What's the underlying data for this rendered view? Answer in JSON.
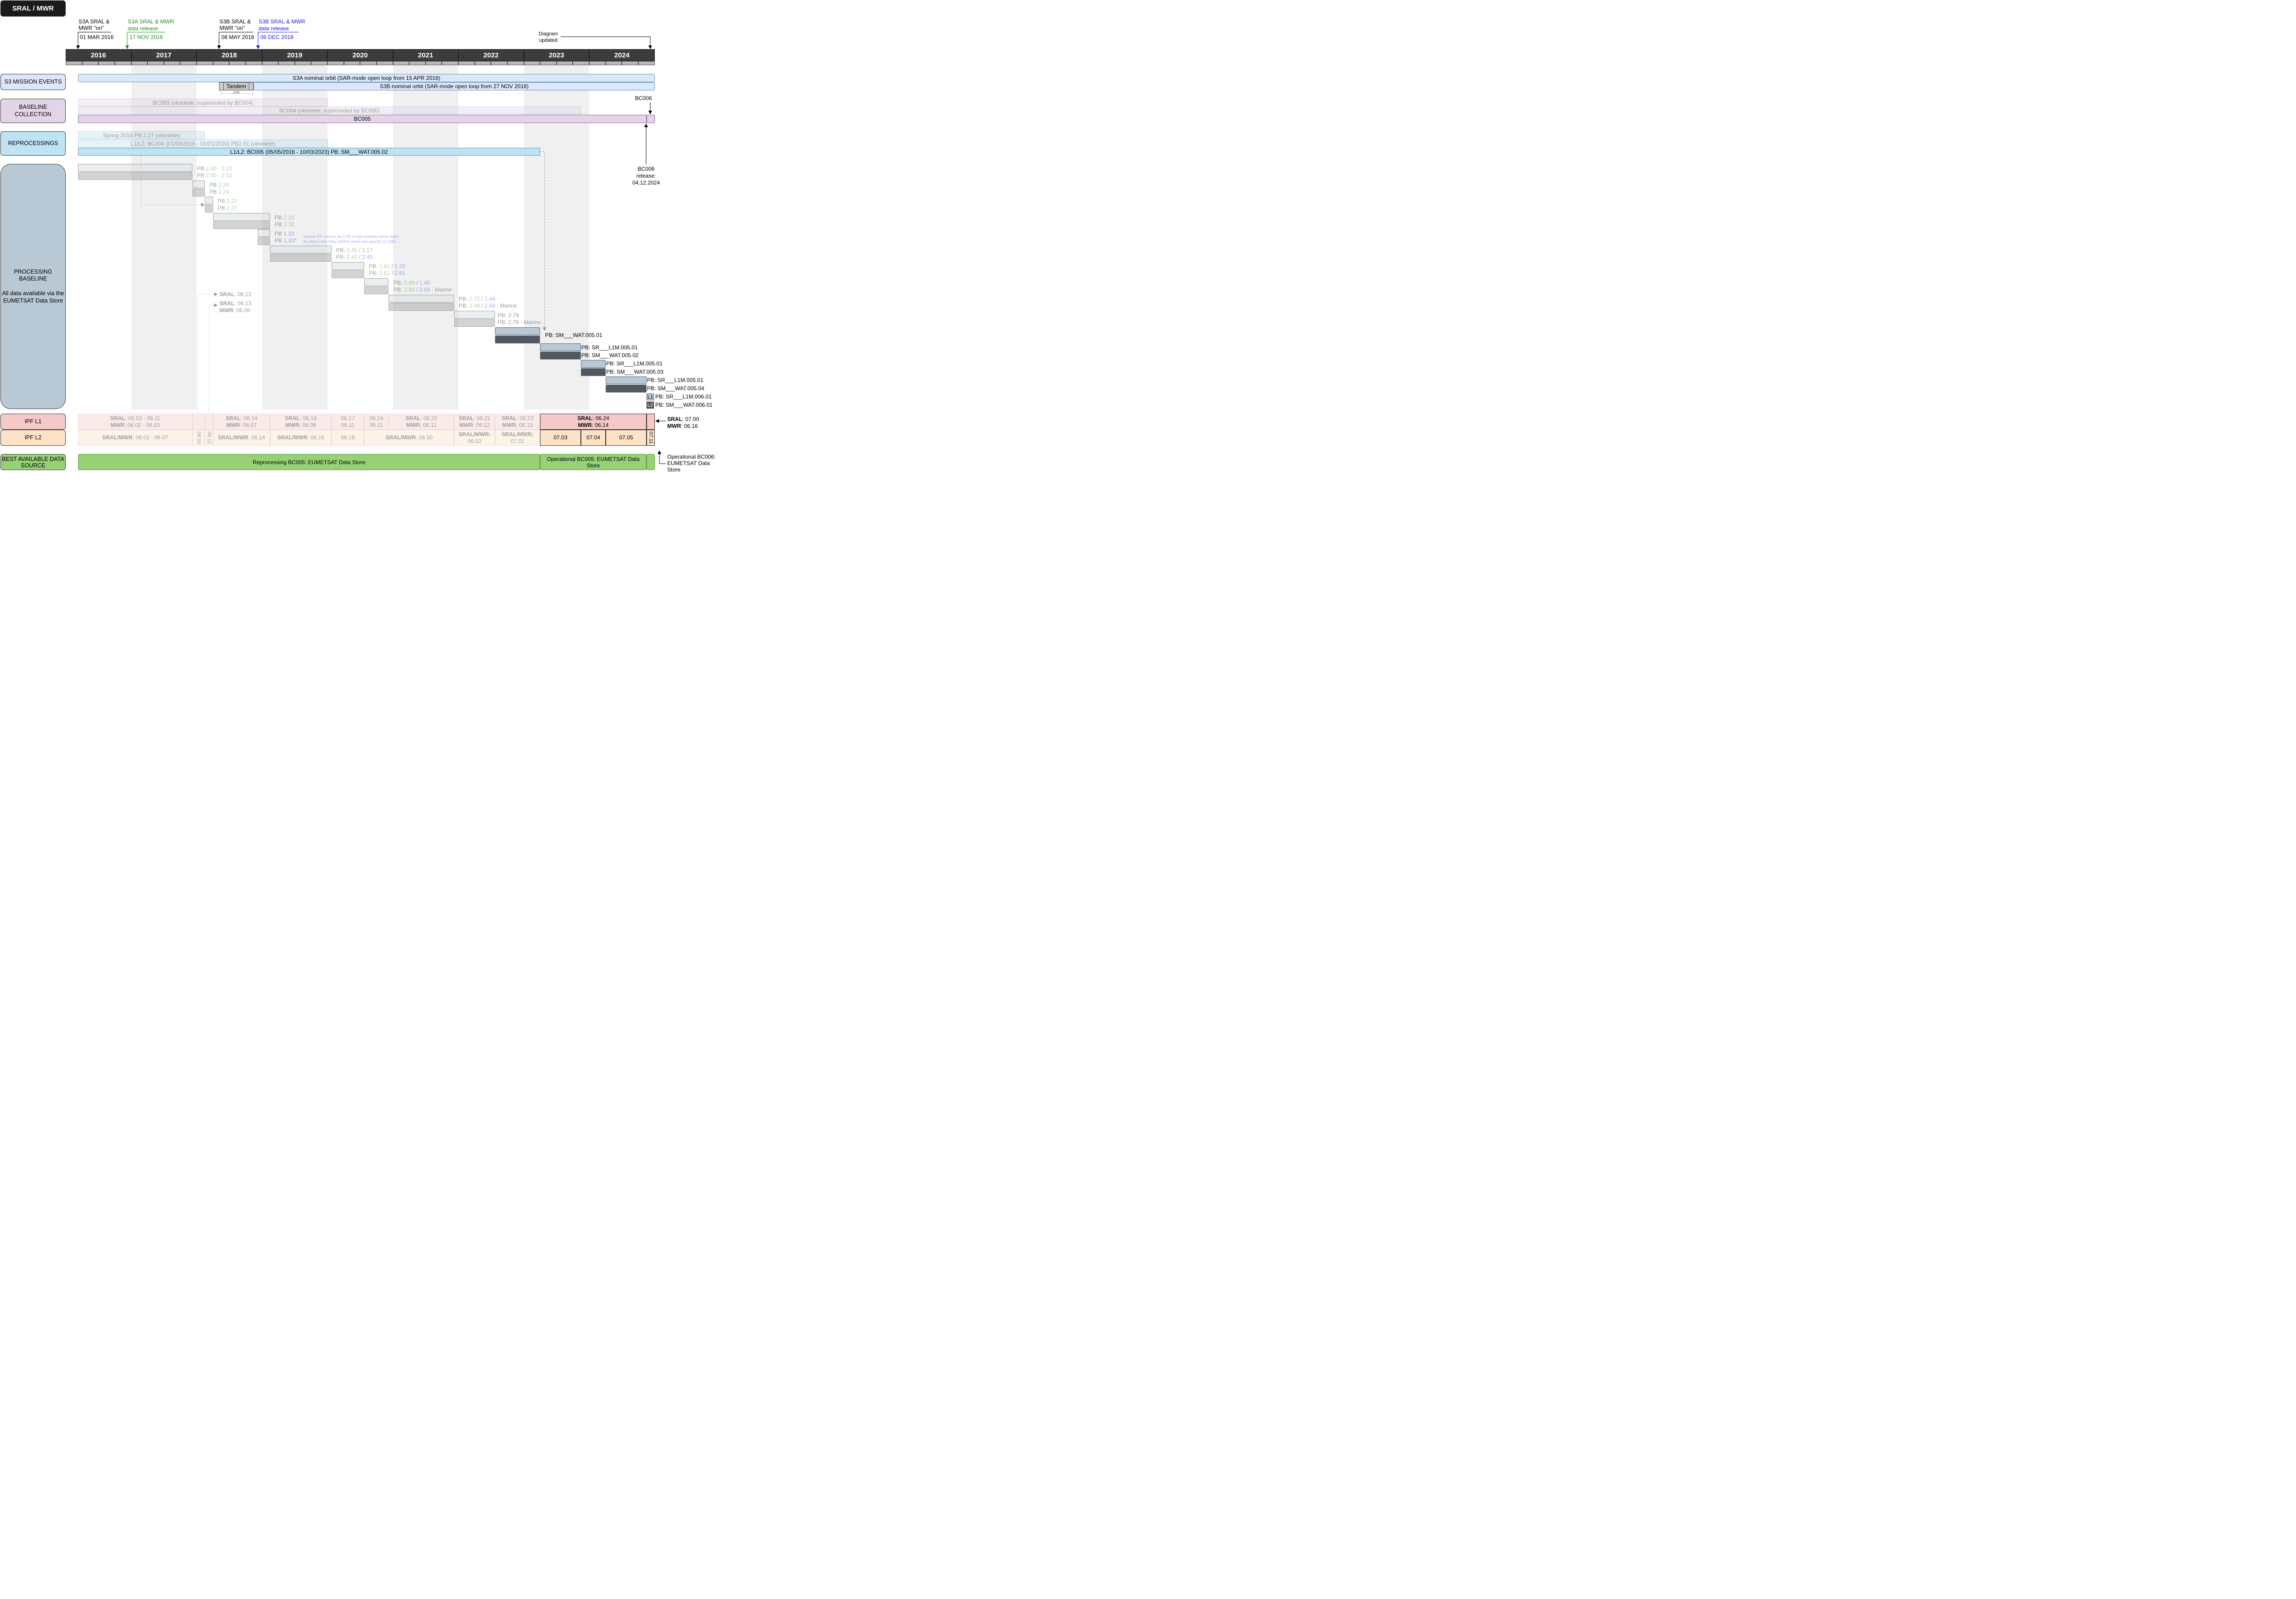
{
  "title": "SRAL / MWR",
  "lanes": {
    "events": "S3 MISSION EVENTS",
    "baseline": "BASELINE COLLECTION",
    "reprocessings": "REPROCESSINGS",
    "processing_title": "PROCESSING BASELINE",
    "processing_sub": "All data available via the EUMETSAT Data Store",
    "ipf_l1": "IPF L1",
    "ipf_l2": "IPF L2",
    "best_source": "BEST AVAILABLE DATA SOURCE"
  },
  "years": [
    "2016",
    "2017",
    "2018",
    "2019",
    "2020",
    "2021",
    "2022",
    "2023",
    "2024"
  ],
  "top_annotations": {
    "s3a_on": "S3A SRAL & MWR \"on\"",
    "s3a_on_date": "01 MAR 2016",
    "s3a_release": "S3A SRAL & MWR data release",
    "s3a_release_date": "17 NOV 2016",
    "s3b_on": "S3B SRAL & MWR \"on\"",
    "s3b_on_date": "08 MAY 2018",
    "s3b_release": "S3B SRAL & MWR data release",
    "s3b_release_date": "06 DEC 2018",
    "diagram_updated": "Diagram updated"
  },
  "events": {
    "s3a_orbit": "S3A nominal orbit (SAR-mode open loop from 15 APR 2016)",
    "tandem": "Tandem",
    "drift": "drift",
    "s3b_orbit": "S3B nominal orbit (SAR-mode open loop from 27 NOV 2018)"
  },
  "baselines": {
    "bc003": "BC003 (obsolete; superseded by BC004)",
    "bc004": "BC004 (obsolete; superseded by BC005)",
    "bc005": "BC005",
    "bc006": "BC006",
    "bc006_release": "BC006 release: 04.12.2024"
  },
  "reprocessings": {
    "spring2018": "Spring 2018 PB 2.27 (obsolete)",
    "bc004": "L1/L2: BC004 (01/03/2016 - 01/01/2020) PB2.61 (obsolete)",
    "bc005": "L1/L2: BC005 (05/05/2016 - 10/03/2023) PB: SM___WAT.005.02"
  },
  "pb_labels": {
    "p1a": "PB ",
    "p1a_v": "2.00 - 2.12",
    "p1b": "PB ",
    "p1b_v": "2.00 - 2.12",
    "p2a": "PB ",
    "p2a_v": "2.24",
    "p2b": "PB ",
    "p2b_v": "2.24",
    "p3a": "PB ",
    "p3a_v": "2.27",
    "p3b": "PB ",
    "p3b_v": "2.27",
    "p4a": "PB ",
    "p4a_v": "2.33",
    "p4b": "PB ",
    "p4b_v": "2.33",
    "p5a": "PB ",
    "p5a_v": "1.33",
    "p5b": "PB ",
    "p5b_v": "1.33*",
    "p5_note1": "*(same IPF version as 2.33; it only includes some static",
    "p5_note2": "Auxiliary Data Files (ADFs) which are specific to S3B)",
    "p6a": "PB: ",
    "p6a_v1": "2.45",
    "p6a_s": " / ",
    "p6a_v2": "1.17",
    "p6b": "PB: ",
    "p6b_v1": "2.45",
    "p6b_s": " / ",
    "p6b_v2": "2.45",
    "p7a": "PB: ",
    "p7a_v1": "2.61",
    "p7a_s": " / ",
    "p7a_v2": "1.33",
    "p7b": "PB: ",
    "p7b_v1": "2.61",
    "p7b_s": " / ",
    "p7b_v2": "2.61",
    "p8a": "PB: ",
    "p8a_v1": "2.69",
    "p8a_s": " / ",
    "p8a_v2": "1.45",
    "p8b": "PB: ",
    "p8b_v1": "2.68",
    "p8b_s": " / ",
    "p8b_v2": "2.68",
    "p8b_m": " - Marine",
    "p9a": "PB: ",
    "p9a_v1": "2.72",
    "p9a_s": " / ",
    "p9a_v2": "1.49",
    "p9b": "PB: ",
    "p9b_v1": "2.68",
    "p9b_s": " / ",
    "p9b_v2": "2.68",
    "p9b_m": " - Marine",
    "p10a": "PB: 2.79",
    "p10b": "PB: 2.79 - Marine",
    "p11": "PB: SM___WAT.005.01",
    "p12a": "PB: SR___L1M.005.01",
    "p12b": "PB: SM___WAT.005.02",
    "p13a": "PB: SR___L1M.005.01",
    "p13b": "PB: SM___WAT.005.03",
    "p14a": "PB: SR___L1M.005.01",
    "p14b": "PB: SM___WAT.005.04",
    "p15_l1": "L1",
    "p15a": "PB: SR___L1M.006.01",
    "p15_l2": "L2",
    "p15b": "PB: SM___WAT.006.01"
  },
  "floating": {
    "sral_a": "SRAL",
    "sral_a_v": ": 06.12",
    "sral_b": "SRAL",
    "sral_b_v": ": 06.13",
    "mwr_b": "MWR",
    "mwr_b_v": ": 06.06"
  },
  "ipf_l1": [
    {
      "l1": "SRAL",
      "v1": ": 06.02 - 06.11",
      "l2": "MWR",
      "v2": ": 06.02 - 06.03"
    },
    {
      "l1": "SRAL",
      "v1": ": 06.14",
      "l2": "MWR",
      "v2": ": 06.07"
    },
    {
      "l1": "SRAL",
      "v1": ": 06.16",
      "l2": "MWR",
      "v2": ": 06.09"
    },
    {
      "l1": "",
      "v1": "06.17",
      "l2": "",
      "v2": "06.11"
    },
    {
      "l1": "",
      "v1": "06.19",
      "l2": "",
      "v2": "06.11"
    },
    {
      "l1": "SRAL",
      "v1": ": 06.20",
      "l2": "MWR",
      "v2": ": 06.11"
    },
    {
      "l1": "SRAL",
      "v1": ": 06.21",
      "l2": "MWR",
      "v2": ": 06.12"
    },
    {
      "l1": "SRAL",
      "v1": ": 06.23",
      "l2": "MWR",
      "v2": ": 06.13"
    },
    {
      "l1": "SRAL",
      "v1": ": 06.24",
      "l2": "MWR",
      "v2": ": 06.14"
    }
  ],
  "ipf_l1_right": {
    "l1": "SRAL",
    "v1": ": 07.00",
    "l2": "MWR",
    "v2": ": 06.16"
  },
  "ipf_l2": {
    "a": "SRAL/MWR",
    "a_v": ": 06.02 - 06.07",
    "v610": "06.10",
    "v612": "06.12",
    "b": "SRAL/MWR",
    "b_v": ": 06.14",
    "c": "SRAL/MWR",
    "c_v": ": 06.15",
    "d": "06.18",
    "e": "SRAL/MWR",
    "e_v": ": 06.50",
    "f": "SRAL/MWR:",
    "f_v": "06.52",
    "g": "SRAL/MWR:",
    "g_v": "07.01",
    "h": "07.03",
    "i": "07.04",
    "j": "07.05",
    "k": "07.11"
  },
  "best_source": {
    "reproc": "Reprocessing BC005: EUMETSAT Data Store",
    "oper": "Operational BC005: EUMETSAT Data Store",
    "oper_bc006": "Operational BC006: EUMETSAT Data Store"
  },
  "colors": {
    "events": "#dbe8fb",
    "baseline": "#e2d5e8",
    "reproc": "#bfe3f2",
    "processing": "#b8c8d4",
    "ipf_l1": "#f6c9c9",
    "ipf_l2": "#fde2c6",
    "best": "#97d077",
    "green": "#1c8f1c",
    "blue": "#1b1be0"
  }
}
